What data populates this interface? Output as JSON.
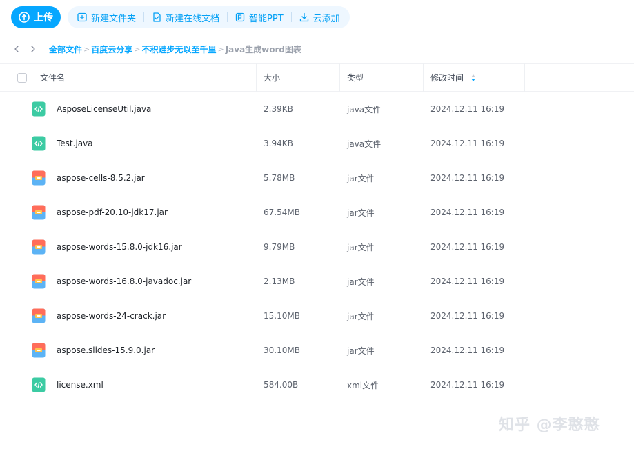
{
  "toolbar": {
    "upload_label": "上传",
    "actions": [
      {
        "label": "新建文件夹",
        "icon": "new-folder-icon"
      },
      {
        "label": "新建在线文档",
        "icon": "new-doc-icon"
      },
      {
        "label": "智能PPT",
        "icon": "smart-ppt-icon"
      },
      {
        "label": "云添加",
        "icon": "cloud-add-icon"
      }
    ]
  },
  "breadcrumb": {
    "items": [
      "全部文件",
      "百度云分享",
      "不积跬步无以至千里"
    ],
    "current": "Java生成word图表",
    "separator": ">"
  },
  "table": {
    "columns": {
      "name": "文件名",
      "size": "大小",
      "type": "类型",
      "modified": "修改时间"
    },
    "rows": [
      {
        "name": "AsposeLicenseUtil.java",
        "size": "2.39KB",
        "type": "java文件",
        "modified": "2024.12.11 16:19",
        "icon": "code-file-icon"
      },
      {
        "name": "Test.java",
        "size": "3.94KB",
        "type": "java文件",
        "modified": "2024.12.11 16:19",
        "icon": "code-file-icon"
      },
      {
        "name": "aspose-cells-8.5.2.jar",
        "size": "5.78MB",
        "type": "jar文件",
        "modified": "2024.12.11 16:19",
        "icon": "archive-file-icon"
      },
      {
        "name": "aspose-pdf-20.10-jdk17.jar",
        "size": "67.54MB",
        "type": "jar文件",
        "modified": "2024.12.11 16:19",
        "icon": "archive-file-icon"
      },
      {
        "name": "aspose-words-15.8.0-jdk16.jar",
        "size": "9.79MB",
        "type": "jar文件",
        "modified": "2024.12.11 16:19",
        "icon": "archive-file-icon"
      },
      {
        "name": "aspose-words-16.8.0-javadoc.jar",
        "size": "2.13MB",
        "type": "jar文件",
        "modified": "2024.12.11 16:19",
        "icon": "archive-file-icon"
      },
      {
        "name": "aspose-words-24-crack.jar",
        "size": "15.10MB",
        "type": "jar文件",
        "modified": "2024.12.11 16:19",
        "icon": "archive-file-icon"
      },
      {
        "name": "aspose.slides-15.9.0.jar",
        "size": "30.10MB",
        "type": "jar文件",
        "modified": "2024.12.11 16:19",
        "icon": "archive-file-icon"
      },
      {
        "name": "license.xml",
        "size": "584.00B",
        "type": "xml文件",
        "modified": "2024.12.11 16:19",
        "icon": "code-file-icon"
      }
    ]
  },
  "watermark": "知乎 @李憨憨",
  "colors": {
    "accent": "#06a7ff",
    "code_icon": "#3ccba3",
    "archive_icon_top": "#ff6d5a",
    "archive_icon_bottom": "#5cb3f5",
    "archive_icon_band": "#ffc44d"
  }
}
